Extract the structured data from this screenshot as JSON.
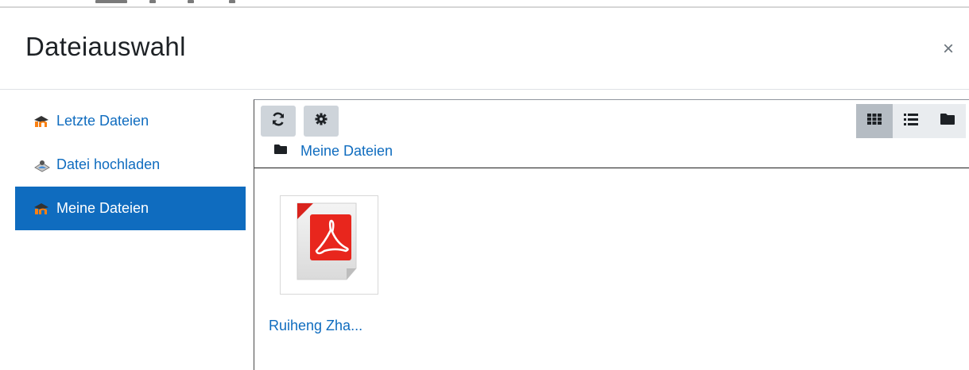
{
  "dialog": {
    "title": "Dateiauswahl",
    "close_symbol": "×"
  },
  "sidebar": {
    "items": [
      {
        "label": "Letzte Dateien",
        "icon": "moodle-icon",
        "active": false
      },
      {
        "label": "Datei hochladen",
        "icon": "upload-icon",
        "active": false
      },
      {
        "label": "Meine Dateien",
        "icon": "moodle-icon",
        "active": true
      }
    ]
  },
  "toolbar": {
    "refresh_icon": "refresh-icon",
    "settings_icon": "gear-icon",
    "views": [
      {
        "icon": "grid-view-icon",
        "active": true
      },
      {
        "icon": "list-view-icon",
        "active": false
      },
      {
        "icon": "tree-view-icon",
        "active": false
      }
    ]
  },
  "breadcrumb": {
    "label": "Meine Dateien",
    "icon": "folder-icon"
  },
  "files": [
    {
      "name": "Ruiheng Zha...",
      "type": "pdf",
      "icon": "pdf-file-icon"
    }
  ],
  "colors": {
    "accent": "#0f6cbf",
    "moodle_orange": "#f98012"
  }
}
